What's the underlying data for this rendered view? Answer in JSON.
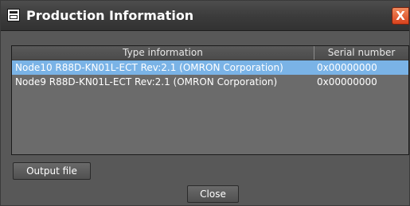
{
  "window": {
    "title": "Production Information",
    "close_glyph": "X"
  },
  "table": {
    "headers": [
      "Type information",
      "Serial number"
    ],
    "rows": [
      {
        "type": "Node10 R88D-KN01L-ECT Rev:2.1 (OMRON Corporation)",
        "serial": "0x00000000",
        "selected": true
      },
      {
        "type": "Node9 R88D-KN01L-ECT Rev:2.1 (OMRON Corporation)",
        "serial": "0x00000000",
        "selected": false
      }
    ]
  },
  "buttons": {
    "output_file": "Output file",
    "close": "Close"
  },
  "colors": {
    "selection": "#7ab3e6",
    "close_button": "#d9421c"
  }
}
